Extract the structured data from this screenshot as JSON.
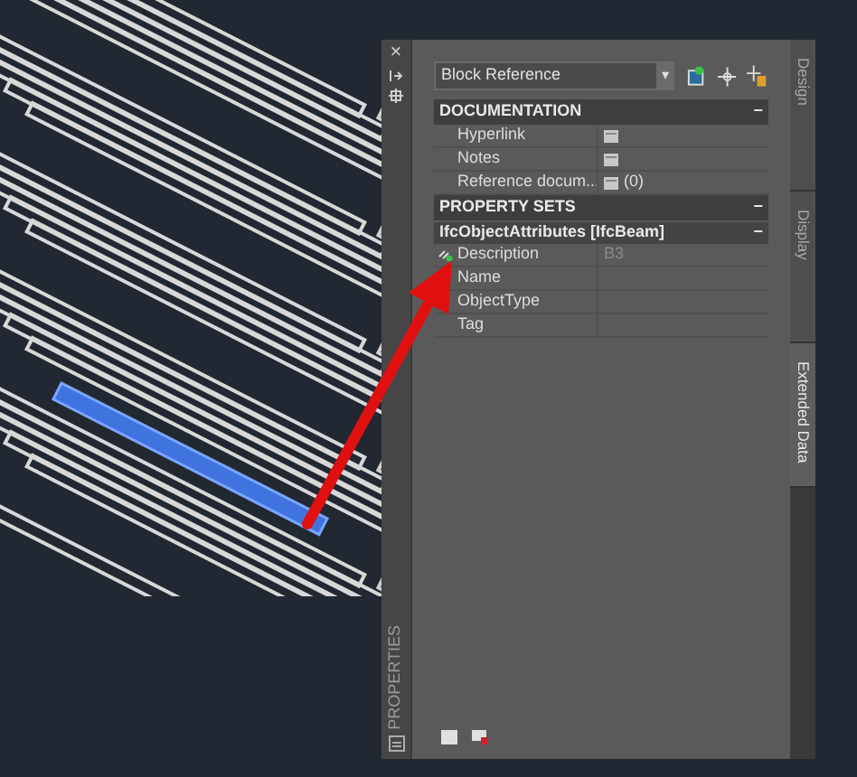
{
  "palette": {
    "title": "PROPERTIES",
    "close": "×"
  },
  "object_type": {
    "value": "Block Reference",
    "caret": "▾"
  },
  "sections": [
    {
      "title": "DOCUMENTATION",
      "mark": "−",
      "expanded": true,
      "groups": [
        {
          "rows": [
            {
              "label": "Hyperlink",
              "kind": "editor"
            },
            {
              "label": "Notes",
              "kind": "editor"
            },
            {
              "label": "Reference docum...",
              "kind": "editor",
              "value": "(0)"
            }
          ]
        }
      ]
    },
    {
      "title": "PROPERTY SETS",
      "mark": "−",
      "expanded": true,
      "groups": [
        {
          "title": "IfcObjectAttributes [IfcBeam]",
          "mark": "−",
          "rows": [
            {
              "label": "Description",
              "kind": "text",
              "value": "B3",
              "linked": true
            },
            {
              "label": "Name",
              "kind": "text"
            },
            {
              "label": "ObjectType",
              "kind": "text"
            },
            {
              "label": "Tag",
              "kind": "text"
            }
          ]
        }
      ]
    }
  ],
  "side_tabs": [
    {
      "label": "Design",
      "selected": false
    },
    {
      "label": "Display",
      "selected": false
    },
    {
      "label": "Extended Data",
      "selected": true
    }
  ]
}
